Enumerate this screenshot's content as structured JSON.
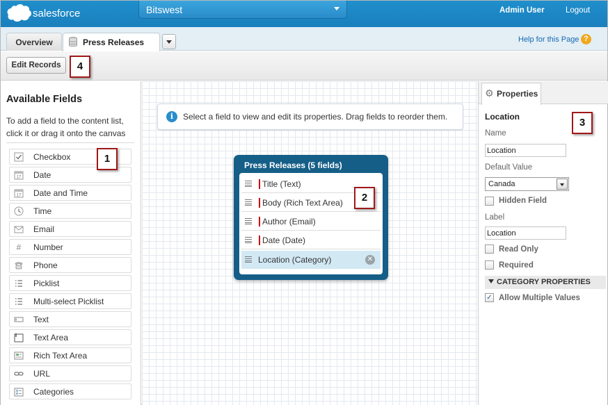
{
  "header": {
    "logo_text": "salesforce",
    "app_name": "Bitswest",
    "user_menu": "Admin User",
    "logout": "Logout"
  },
  "tabs": {
    "overview": "Overview",
    "press_releases": "Press Releases",
    "help_link": "Help for this Page",
    "help_icon": "?"
  },
  "toolbar": {
    "edit_records": "Edit Records"
  },
  "callouts": [
    "1",
    "2",
    "3",
    "4"
  ],
  "available_fields": {
    "title": "Available Fields",
    "help": "To add a field to the content list, click it or drag it onto the canvas",
    "items": [
      {
        "label": "Checkbox",
        "icon": "checkbox-icon"
      },
      {
        "label": "Date",
        "icon": "calendar-icon"
      },
      {
        "label": "Date and Time",
        "icon": "calendar-icon"
      },
      {
        "label": "Time",
        "icon": "clock-icon"
      },
      {
        "label": "Email",
        "icon": "email-icon"
      },
      {
        "label": "Number",
        "icon": "hash-icon"
      },
      {
        "label": "Phone",
        "icon": "phone-icon"
      },
      {
        "label": "Picklist",
        "icon": "list-icon"
      },
      {
        "label": "Multi-select Picklist",
        "icon": "list-icon"
      },
      {
        "label": "Text",
        "icon": "text-field-icon"
      },
      {
        "label": "Text Area",
        "icon": "text-area-icon"
      },
      {
        "label": "Rich Text Area",
        "icon": "rich-text-icon"
      },
      {
        "label": "URL",
        "icon": "link-icon"
      },
      {
        "label": "Categories",
        "icon": "categories-icon"
      }
    ]
  },
  "canvas": {
    "info_message": "Select a field to view and edit its properties. Drag fields to reorder them.",
    "card_title": "Press Releases (5 fields)",
    "fields": [
      {
        "label": "Title (Text)",
        "required": true
      },
      {
        "label": "Body (Rich Text Area)",
        "required": true
      },
      {
        "label": "Author (Email)",
        "required": true
      },
      {
        "label": "Date (Date)",
        "required": true
      },
      {
        "label": "Location (Category)",
        "required": false,
        "selected": true
      }
    ]
  },
  "properties": {
    "tab_label": "Properties",
    "field_title": "Location",
    "name_label": "Name",
    "name_value": "Location",
    "default_value_label": "Default Value",
    "default_value": "Canada",
    "hidden_field": "Hidden Field",
    "label_label": "Label",
    "label_value": "Location",
    "read_only": "Read Only",
    "required": "Required",
    "category_section": "CATEGORY PROPERTIES",
    "allow_multiple": "Allow Multiple Values",
    "allow_multiple_checked": true
  },
  "colors": {
    "header_blue": "#1a7fbd",
    "card_blue": "#155e87",
    "required_marker": "#cc0000",
    "callout_border": "#a01818"
  }
}
